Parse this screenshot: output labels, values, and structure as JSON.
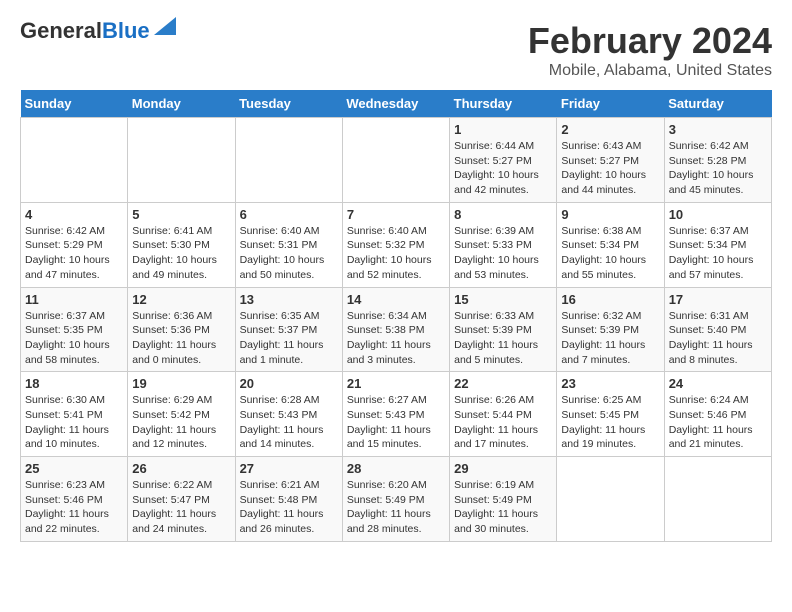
{
  "header": {
    "logo_general": "General",
    "logo_blue": "Blue",
    "title": "February 2024",
    "subtitle": "Mobile, Alabama, United States"
  },
  "days_of_week": [
    "Sunday",
    "Monday",
    "Tuesday",
    "Wednesday",
    "Thursday",
    "Friday",
    "Saturday"
  ],
  "weeks": [
    [
      {
        "day": "",
        "info": ""
      },
      {
        "day": "",
        "info": ""
      },
      {
        "day": "",
        "info": ""
      },
      {
        "day": "",
        "info": ""
      },
      {
        "day": "1",
        "info": "Sunrise: 6:44 AM\nSunset: 5:27 PM\nDaylight: 10 hours and 42 minutes."
      },
      {
        "day": "2",
        "info": "Sunrise: 6:43 AM\nSunset: 5:27 PM\nDaylight: 10 hours and 44 minutes."
      },
      {
        "day": "3",
        "info": "Sunrise: 6:42 AM\nSunset: 5:28 PM\nDaylight: 10 hours and 45 minutes."
      }
    ],
    [
      {
        "day": "4",
        "info": "Sunrise: 6:42 AM\nSunset: 5:29 PM\nDaylight: 10 hours and 47 minutes."
      },
      {
        "day": "5",
        "info": "Sunrise: 6:41 AM\nSunset: 5:30 PM\nDaylight: 10 hours and 49 minutes."
      },
      {
        "day": "6",
        "info": "Sunrise: 6:40 AM\nSunset: 5:31 PM\nDaylight: 10 hours and 50 minutes."
      },
      {
        "day": "7",
        "info": "Sunrise: 6:40 AM\nSunset: 5:32 PM\nDaylight: 10 hours and 52 minutes."
      },
      {
        "day": "8",
        "info": "Sunrise: 6:39 AM\nSunset: 5:33 PM\nDaylight: 10 hours and 53 minutes."
      },
      {
        "day": "9",
        "info": "Sunrise: 6:38 AM\nSunset: 5:34 PM\nDaylight: 10 hours and 55 minutes."
      },
      {
        "day": "10",
        "info": "Sunrise: 6:37 AM\nSunset: 5:34 PM\nDaylight: 10 hours and 57 minutes."
      }
    ],
    [
      {
        "day": "11",
        "info": "Sunrise: 6:37 AM\nSunset: 5:35 PM\nDaylight: 10 hours and 58 minutes."
      },
      {
        "day": "12",
        "info": "Sunrise: 6:36 AM\nSunset: 5:36 PM\nDaylight: 11 hours and 0 minutes."
      },
      {
        "day": "13",
        "info": "Sunrise: 6:35 AM\nSunset: 5:37 PM\nDaylight: 11 hours and 1 minute."
      },
      {
        "day": "14",
        "info": "Sunrise: 6:34 AM\nSunset: 5:38 PM\nDaylight: 11 hours and 3 minutes."
      },
      {
        "day": "15",
        "info": "Sunrise: 6:33 AM\nSunset: 5:39 PM\nDaylight: 11 hours and 5 minutes."
      },
      {
        "day": "16",
        "info": "Sunrise: 6:32 AM\nSunset: 5:39 PM\nDaylight: 11 hours and 7 minutes."
      },
      {
        "day": "17",
        "info": "Sunrise: 6:31 AM\nSunset: 5:40 PM\nDaylight: 11 hours and 8 minutes."
      }
    ],
    [
      {
        "day": "18",
        "info": "Sunrise: 6:30 AM\nSunset: 5:41 PM\nDaylight: 11 hours and 10 minutes."
      },
      {
        "day": "19",
        "info": "Sunrise: 6:29 AM\nSunset: 5:42 PM\nDaylight: 11 hours and 12 minutes."
      },
      {
        "day": "20",
        "info": "Sunrise: 6:28 AM\nSunset: 5:43 PM\nDaylight: 11 hours and 14 minutes."
      },
      {
        "day": "21",
        "info": "Sunrise: 6:27 AM\nSunset: 5:43 PM\nDaylight: 11 hours and 15 minutes."
      },
      {
        "day": "22",
        "info": "Sunrise: 6:26 AM\nSunset: 5:44 PM\nDaylight: 11 hours and 17 minutes."
      },
      {
        "day": "23",
        "info": "Sunrise: 6:25 AM\nSunset: 5:45 PM\nDaylight: 11 hours and 19 minutes."
      },
      {
        "day": "24",
        "info": "Sunrise: 6:24 AM\nSunset: 5:46 PM\nDaylight: 11 hours and 21 minutes."
      }
    ],
    [
      {
        "day": "25",
        "info": "Sunrise: 6:23 AM\nSunset: 5:46 PM\nDaylight: 11 hours and 22 minutes."
      },
      {
        "day": "26",
        "info": "Sunrise: 6:22 AM\nSunset: 5:47 PM\nDaylight: 11 hours and 24 minutes."
      },
      {
        "day": "27",
        "info": "Sunrise: 6:21 AM\nSunset: 5:48 PM\nDaylight: 11 hours and 26 minutes."
      },
      {
        "day": "28",
        "info": "Sunrise: 6:20 AM\nSunset: 5:49 PM\nDaylight: 11 hours and 28 minutes."
      },
      {
        "day": "29",
        "info": "Sunrise: 6:19 AM\nSunset: 5:49 PM\nDaylight: 11 hours and 30 minutes."
      },
      {
        "day": "",
        "info": ""
      },
      {
        "day": "",
        "info": ""
      }
    ]
  ]
}
